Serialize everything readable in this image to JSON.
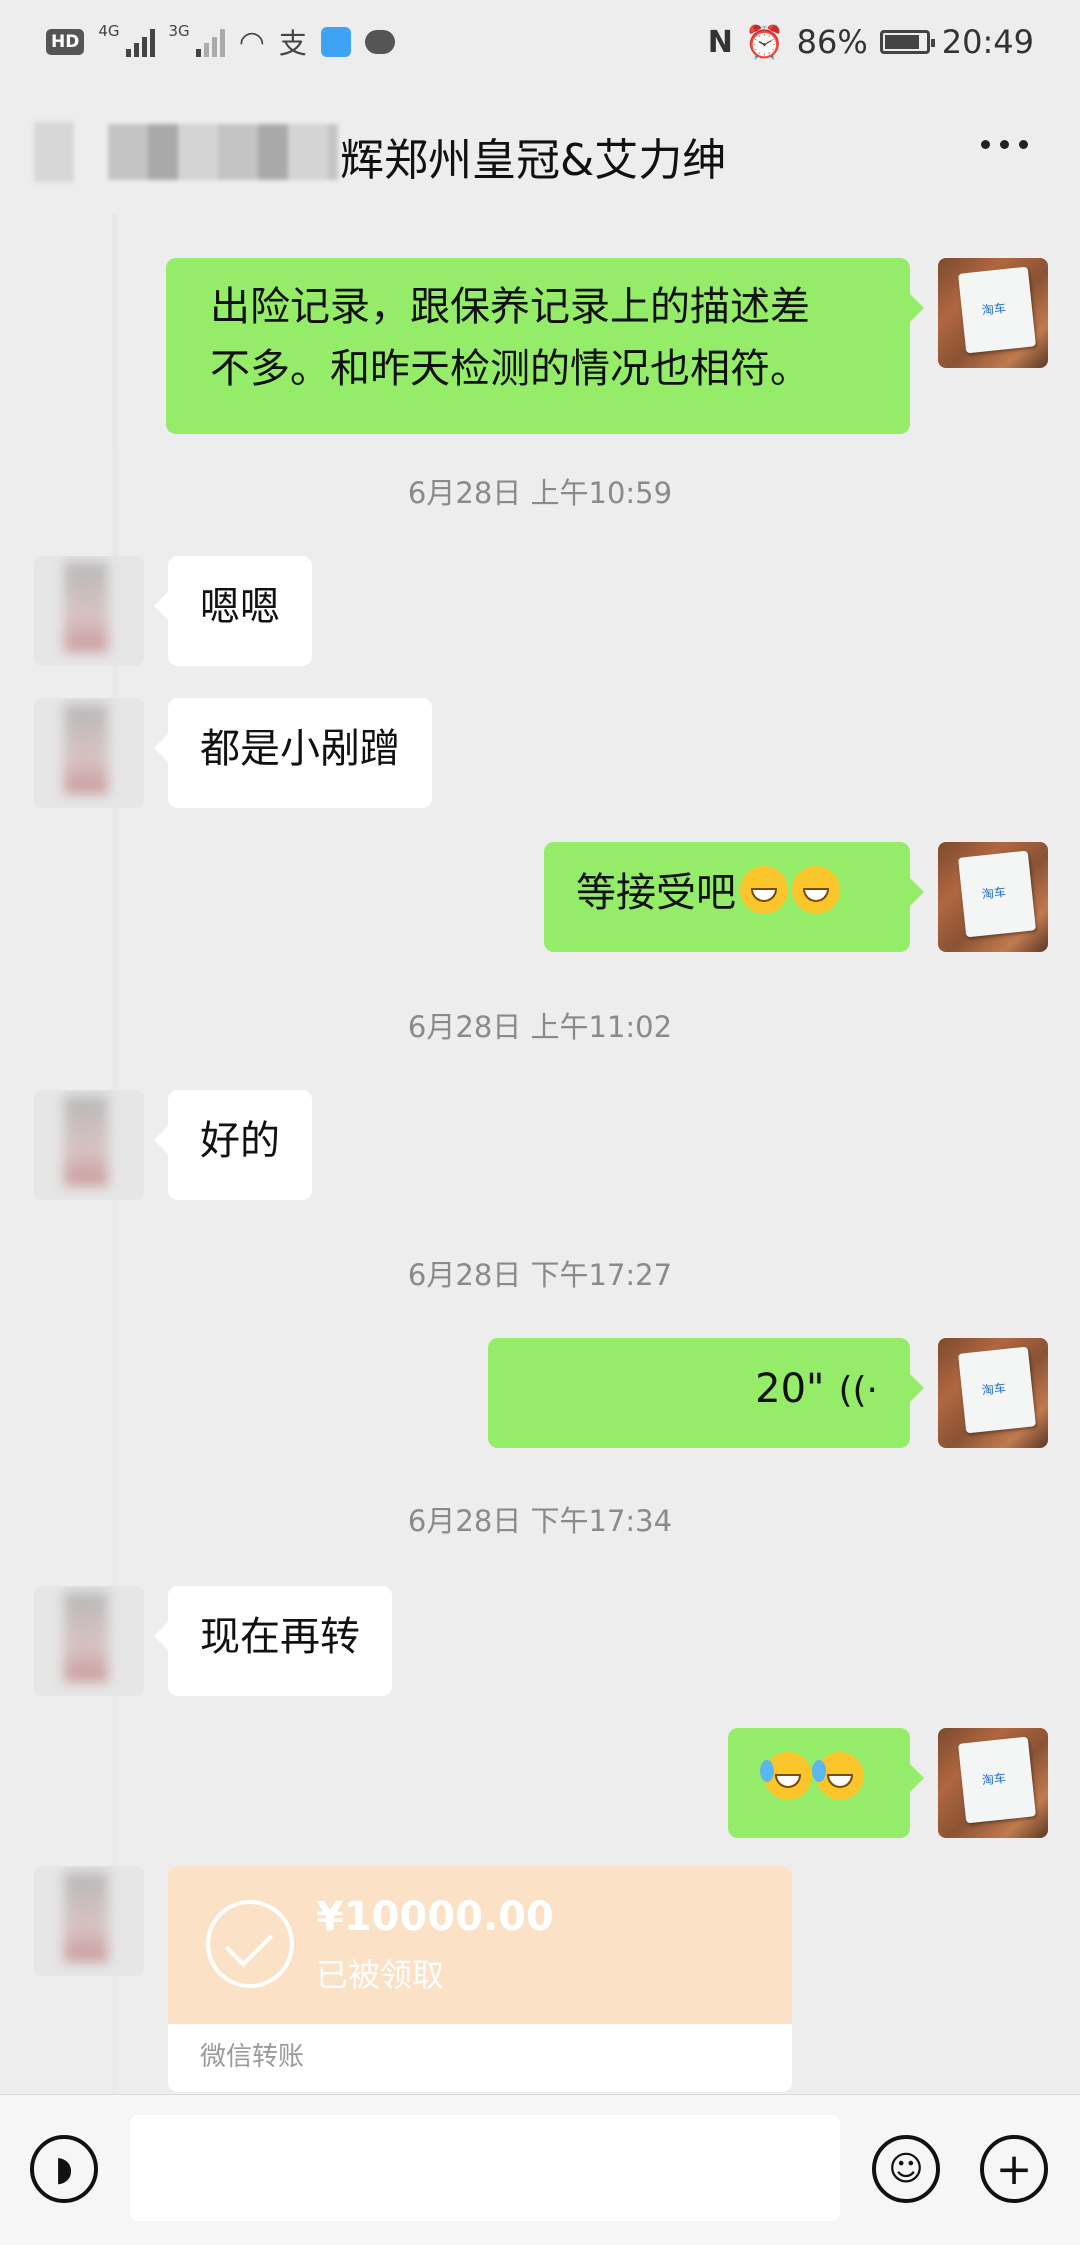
{
  "status_bar": {
    "hd": "HD",
    "net1": "4G",
    "net2": "3G",
    "battery": "86%",
    "battery_level": 0.86,
    "time": "20:49"
  },
  "nav": {
    "title": "辉郑州皇冠&艾力绅"
  },
  "messages": [
    {
      "side": "self",
      "type": "text",
      "lines": [
        "出险记录，跟保养记录上的描述差",
        "不多。和昨天检测的情况也相符。"
      ]
    },
    {
      "type": "time",
      "text": "6月28日 上午10:59"
    },
    {
      "side": "other",
      "type": "text",
      "text": "嗯嗯"
    },
    {
      "side": "other",
      "type": "text",
      "text": "都是小剐蹭"
    },
    {
      "side": "self",
      "type": "text",
      "text": "等接受吧"
    },
    {
      "type": "time",
      "text": "6月28日 上午11:02"
    },
    {
      "side": "other",
      "type": "text",
      "text": "好的"
    },
    {
      "type": "time",
      "text": "6月28日 下午17:27"
    },
    {
      "side": "self",
      "type": "voice",
      "duration": "20\""
    },
    {
      "type": "time",
      "text": "6月28日 下午17:34"
    },
    {
      "side": "other",
      "type": "text",
      "text": "现在再转"
    },
    {
      "side": "self",
      "type": "emoji"
    },
    {
      "side": "other",
      "type": "transfer",
      "amount": "¥10000.00",
      "status": "已被领取",
      "label": "微信转账"
    }
  ],
  "colors": {
    "self_bubble": "#95ec69",
    "other_bubble": "#ffffff",
    "background": "#ededed",
    "transfer_card": "#fbe1c6"
  },
  "icons": {
    "voice_mode": "voice-mode-icon",
    "emoji": "emoji-face-icon",
    "plus": "plus-icon",
    "more": "more-dots-icon"
  }
}
